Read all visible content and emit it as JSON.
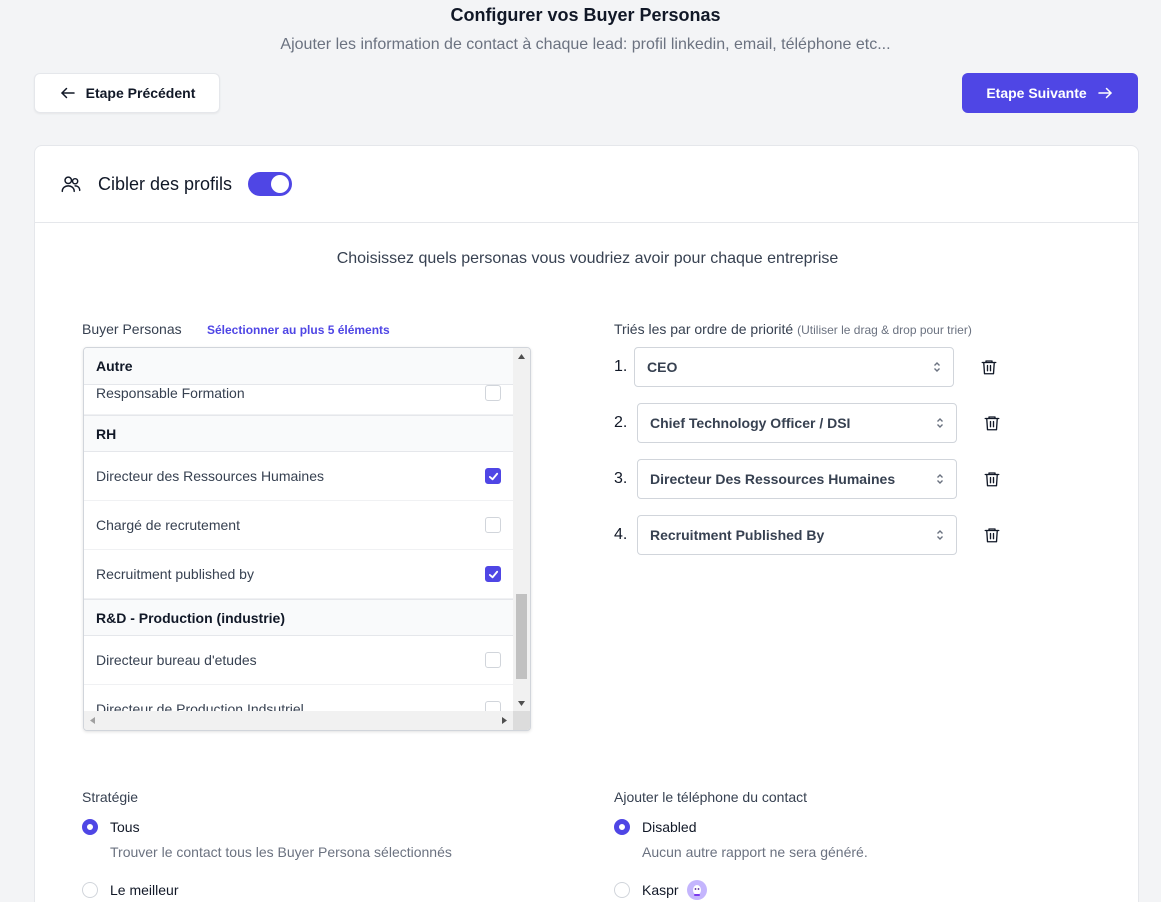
{
  "header": {
    "title": "Configurer vos Buyer Personas",
    "subtitle": "Ajouter les information de contact à chaque lead: profil linkedin, email, téléphone etc..."
  },
  "nav": {
    "prev_label": "Etape Précédent",
    "next_label": "Etape Suivante",
    "accent": "#4f46e5"
  },
  "card": {
    "title": "Cibler des profils",
    "toggle_on": true,
    "intro": "Choisissez quels personas vous voudriez avoir pour chaque entreprise"
  },
  "personas": {
    "label": "Buyer Personas",
    "max_hint": "Sélectionner au plus 5 éléments",
    "groups": [
      {
        "name": "Autre",
        "items": [
          {
            "label": "Responsable Formation",
            "checked": false
          }
        ]
      },
      {
        "name": "RH",
        "items": [
          {
            "label": "Directeur des Ressources Humaines",
            "checked": true
          },
          {
            "label": "Chargé de recrutement",
            "checked": false
          },
          {
            "label": "Recruitment published by",
            "checked": true
          }
        ]
      },
      {
        "name": "R&D - Production (industrie)",
        "items": [
          {
            "label": "Directeur bureau d'etudes",
            "checked": false
          },
          {
            "label": "Directeur de Production Indsutriel",
            "checked": false
          }
        ]
      }
    ]
  },
  "priority": {
    "label": "Triés les par ordre de priorité",
    "hint": "(Utiliser le drag & drop pour trier)",
    "items": [
      {
        "num": "1.",
        "value": "CEO"
      },
      {
        "num": "2.",
        "value": "Chief Technology Officer / DSI"
      },
      {
        "num": "3.",
        "value": "Directeur Des Ressources Humaines"
      },
      {
        "num": "4.",
        "value": "Recruitment Published By"
      }
    ]
  },
  "strategy": {
    "label": "Stratégie",
    "options": [
      {
        "label": "Tous",
        "desc": "Trouver le contact tous les Buyer Persona sélectionnés",
        "selected": true
      },
      {
        "label": "Le meilleur",
        "selected": false
      }
    ]
  },
  "phone": {
    "label": "Ajouter le téléphone du contact",
    "options": [
      {
        "label": "Disabled",
        "desc": "Aucun autre rapport ne sera généré.",
        "selected": true
      },
      {
        "label": "Kaspr",
        "selected": false,
        "icon": "kaspr-logo-icon"
      }
    ]
  }
}
